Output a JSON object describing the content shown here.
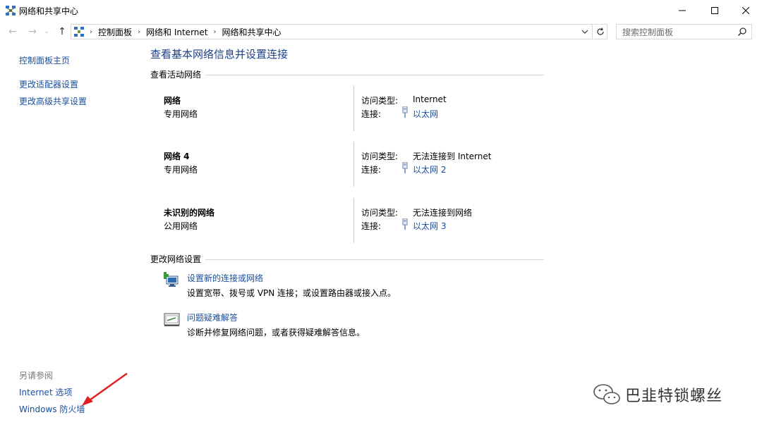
{
  "window": {
    "title": "网络和共享中心",
    "min_glyph": "—",
    "max_glyph": "☐",
    "close_glyph": "✕"
  },
  "nav": {
    "back_glyph": "←",
    "forward_glyph": "→",
    "recent_glyph": "⌄",
    "up_glyph": "↑",
    "breadcrumbs": [
      "控制面板",
      "网络和 Internet",
      "网络和共享中心"
    ],
    "search_placeholder": "搜索控制面板"
  },
  "left_pane": {
    "home": "控制面板主页",
    "adapter": "更改适配器设置",
    "advanced_sharing": "更改高级共享设置",
    "see_also": "另请参阅",
    "internet_options": "Internet 选项",
    "firewall": "Windows 防火墙"
  },
  "main": {
    "title": "查看基本网络信息并设置连接",
    "active_networks_header": "查看活动网络",
    "change_settings_header": "更改网络设置",
    "access_type_label": "访问类型:",
    "connection_label": "连接:",
    "networks": [
      {
        "name": "网络",
        "category": "专用网络",
        "access_type": "Internet",
        "connection": "以太网"
      },
      {
        "name": "网络  4",
        "category": "专用网络",
        "access_type": "无法连接到 Internet",
        "connection": "以太网 2"
      },
      {
        "name": "未识别的网络",
        "category": "公用网络",
        "access_type": "无法连接到网络",
        "connection": "以太网 3"
      }
    ],
    "tasks": [
      {
        "link": "设置新的连接或网络",
        "desc": "设置宽带、拨号或 VPN 连接；或设置路由器或接入点。",
        "icon": "new-connection-icon"
      },
      {
        "link": "问题疑难解答",
        "desc": "诊断并修复网络问题，或者获得疑难解答信息。",
        "icon": "troubleshoot-icon"
      }
    ]
  },
  "watermark": {
    "text": "巴韭特锁螺丝"
  },
  "colors": {
    "link": "#1a4f9c",
    "title": "#1e3f8a",
    "annotation_arrow": "#e02020"
  }
}
